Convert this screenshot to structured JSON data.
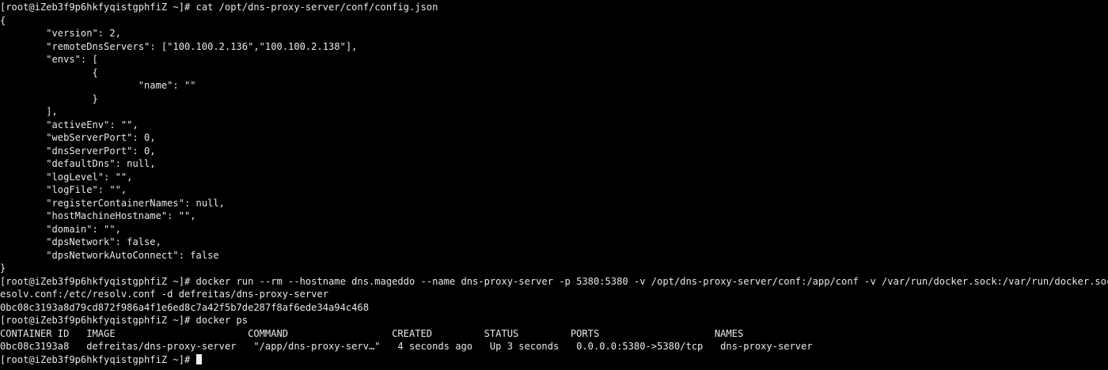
{
  "terminal": {
    "background": "#000000",
    "foreground": "#e8e8e8",
    "lines": [
      "[root@iZeb3f9p6hkfyqistgphfiZ ~]# cat /opt/dns-proxy-server/conf/config.json",
      "{",
      "        \"version\": 2,",
      "        \"remoteDnsServers\": [\"100.100.2.136\",\"100.100.2.138\"],",
      "        \"envs\": [",
      "                {",
      "                        \"name\": \"\"",
      "                }",
      "        ],",
      "        \"activeEnv\": \"\",",
      "        \"webServerPort\": 0,",
      "        \"dnsServerPort\": 0,",
      "        \"defaultDns\": null,",
      "        \"logLevel\": \"\",",
      "        \"logFile\": \"\",",
      "        \"registerContainerNames\": null,",
      "        \"hostMachineHostname\": \"\",",
      "        \"domain\": \"\",",
      "        \"dpsNetwork\": false,",
      "        \"dpsNetworkAutoConnect\": false",
      "}",
      "[root@iZeb3f9p6hkfyqistgphfiZ ~]# docker run --rm --hostname dns.mageddo --name dns-proxy-server -p 5380:5380 -v /opt/dns-proxy-server/conf:/app/conf -v /var/run/docker.sock:/var/run/docker.sock -v /etc/r",
      "esolv.conf:/etc/resolv.conf -d defreitas/dns-proxy-server",
      "0bc08c3193a8d79cd872f986a4f1e6ed8c7a42f5b7de287f8af6ede34a94c468",
      "[root@iZeb3f9p6hkfyqistgphfiZ ~]# docker ps",
      "CONTAINER ID   IMAGE                       COMMAND                  CREATED         STATUS         PORTS                    NAMES",
      "0bc08c3193a8   defreitas/dns-proxy-server   \"/app/dns-proxy-serv…\"   4 seconds ago   Up 3 seconds   0.0.0.0:5380->5380/tcp   dns-proxy-server"
    ],
    "prompt": "[root@iZeb3f9p6hkfyqistgphfiZ ~]# "
  }
}
